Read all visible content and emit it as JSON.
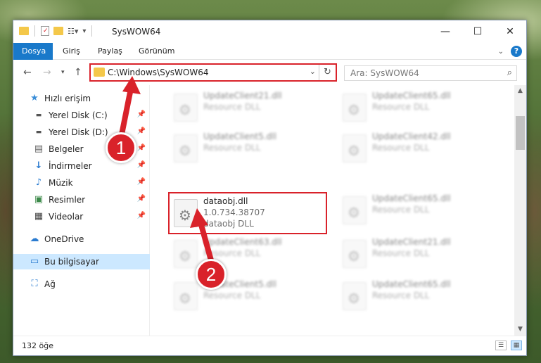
{
  "window": {
    "title": "SysWOW64",
    "controls": {
      "minimize": "—",
      "maximize": "☐",
      "close": "✕"
    }
  },
  "ribbon": {
    "tabs": [
      "Dosya",
      "Giriş",
      "Paylaş",
      "Görünüm"
    ],
    "active_tab": "Dosya",
    "help": "?"
  },
  "address": {
    "path": "C:\\Windows\\SysWOW64",
    "search_placeholder": "Ara: SysWOW64"
  },
  "nav": {
    "items": [
      {
        "label": "Hızlı erişim",
        "icon": "star-icon",
        "pinned": false
      },
      {
        "label": "Yerel Disk (C:)",
        "icon": "drive-icon",
        "pinned": true
      },
      {
        "label": "Yerel Disk (D:)",
        "icon": "drive-icon",
        "pinned": true
      },
      {
        "label": "Belgeler",
        "icon": "document-icon",
        "pinned": true
      },
      {
        "label": "İndirmeler",
        "icon": "download-icon",
        "pinned": true
      },
      {
        "label": "Müzik",
        "icon": "music-icon",
        "pinned": true
      },
      {
        "label": "Resimler",
        "icon": "picture-icon",
        "pinned": true
      },
      {
        "label": "Videolar",
        "icon": "video-icon",
        "pinned": true
      },
      {
        "label": "OneDrive",
        "icon": "cloud-icon",
        "pinned": false
      },
      {
        "label": "Bu bilgisayar",
        "icon": "computer-icon",
        "pinned": false,
        "selected": true
      },
      {
        "label": "Ağ",
        "icon": "network-icon",
        "pinned": false
      }
    ]
  },
  "files": [
    {
      "name": "UpdateClient21.dll",
      "line1": "Resource DLL",
      "line2": ""
    },
    {
      "name": "UpdateClient65.dll",
      "line1": "Resource DLL",
      "line2": ""
    },
    {
      "name": "UpdateClient5.dll",
      "line1": "Resource DLL",
      "line2": ""
    },
    {
      "name": "UpdateClient42.dll",
      "line1": "Resource DLL",
      "line2": ""
    },
    {
      "name": "dataobj.dll",
      "line1": "1.0.734.38707",
      "line2": "dataobj DLL",
      "highlighted": true
    },
    {
      "name": "UpdateClient65.dll",
      "line1": "Resource DLL",
      "line2": ""
    },
    {
      "name": "UpdateClient63.dll",
      "line1": "Resource DLL",
      "line2": ""
    },
    {
      "name": "UpdateClient21.dll",
      "line1": "Resource DLL",
      "line2": ""
    },
    {
      "name": "UpdateClient5.dll",
      "line1": "Resource DLL",
      "line2": ""
    },
    {
      "name": "UpdateClient65.dll",
      "line1": "Resource DLL",
      "line2": ""
    }
  ],
  "status": {
    "count": "132 öğe"
  },
  "annotations": {
    "step1": "1",
    "step2": "2",
    "color": "#d9222a"
  }
}
